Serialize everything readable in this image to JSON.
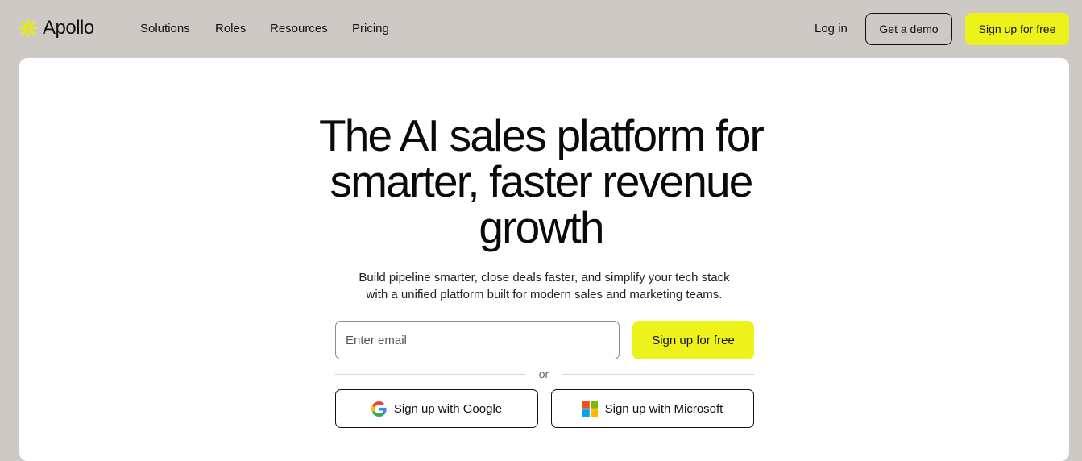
{
  "brand": {
    "name": "Apollo",
    "logo_icon": "apollo-sunburst-icon",
    "accent_color": "#eef21b"
  },
  "nav": {
    "links": [
      "Solutions",
      "Roles",
      "Resources",
      "Pricing"
    ],
    "login_label": "Log in",
    "demo_label": "Get a demo",
    "signup_label": "Sign up for free"
  },
  "hero": {
    "headline_lines": [
      "The AI sales platform for",
      "smarter, faster revenue",
      "growth"
    ],
    "subhead_lines": [
      "Build pipeline smarter, close deals faster, and simplify your tech stack",
      "with a unified platform built for modern sales and marketing teams."
    ],
    "email_placeholder": "Enter email",
    "signup_label": "Sign up for free",
    "divider_text": "or",
    "google_label": "Sign up with Google",
    "google_icon": "google-g-icon",
    "microsoft_label": "Sign up with Microsoft",
    "microsoft_icon": "microsoft-logo-icon"
  }
}
